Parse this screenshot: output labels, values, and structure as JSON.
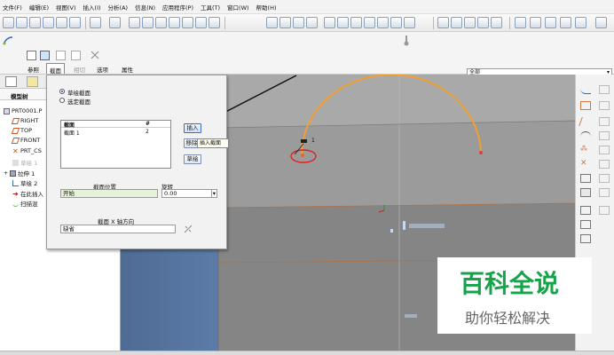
{
  "menubar": {
    "items": [
      "文件(F)",
      "编辑(E)",
      "视图(V)",
      "插入(I)",
      "分析(A)",
      "信息(N)",
      "应用程序(P)",
      "工具(T)",
      "窗口(W)",
      "帮助(H)"
    ]
  },
  "dashboard": {
    "tabs": [
      "参照",
      "截面",
      "相切",
      "选项",
      "属性"
    ],
    "active_tab": "截面",
    "filter_value": "全部"
  },
  "model_tree": {
    "header": "模型树",
    "items": [
      "PRT0001.P",
      "RIGHT",
      "TOP",
      "FRONT",
      "PRT_CS",
      "草绘 1",
      "拉伸 1",
      "草绘 2",
      "在此插入",
      "扫描混"
    ]
  },
  "section_dialog": {
    "radio_sketched": "草绘截面",
    "radio_selected": "选定截面",
    "list_col_section": "截面",
    "list_col_num": "#",
    "list_row_section": "截面 1",
    "list_row_num": "2",
    "insert_button": "插入",
    "remove_button": "移除",
    "sketch_button": "草绘",
    "insert_tooltip": "插入截面",
    "section_location_label": "截面位置",
    "section_location_value": "开始",
    "rotation_label": "旋转",
    "rotation_value": "0.00",
    "x_axis_label": "截面 X 轴方向",
    "x_axis_value": "缺省"
  },
  "viewport": {
    "point_label": "1"
  },
  "watermark": {
    "title": "百科全说",
    "subtitle": "助你轻松解决"
  },
  "colors": {
    "arc": "#f0a030",
    "annotation_circle": "#e02020",
    "watermark_green": "#16a44a"
  }
}
